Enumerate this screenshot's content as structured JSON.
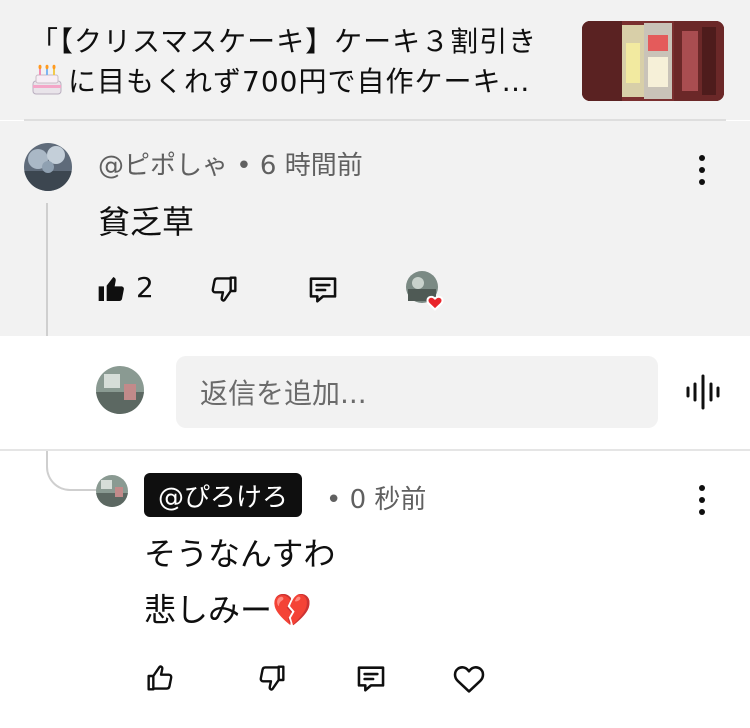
{
  "video": {
    "title_line1": "「【クリスマスケーキ】ケーキ３割引き",
    "title_line2": "に目もくれず700円で自作ケーキ…",
    "title_emoji": "birthday-cake-emoji"
  },
  "parent_comment": {
    "handle": "@ピポしゃ",
    "separator": "•",
    "time": "6 時間前",
    "text": "貧乏草",
    "like_count": "2"
  },
  "reply_box": {
    "placeholder": "返信を追加..."
  },
  "reply": {
    "handle": "@ぴろけろ",
    "separator": "•",
    "time": "0 秒前",
    "line1": "そうなんすわ",
    "line2": "悲しみー💔"
  },
  "icons": {
    "like": "thumbs-up-icon",
    "dislike": "thumbs-down-icon",
    "reply": "comment-icon",
    "heart": "heart-icon",
    "more": "more-vert-icon",
    "voice": "voice-search-icon"
  },
  "colors": {
    "heart_red": "#e9252b",
    "secondary_text": "#606060"
  }
}
